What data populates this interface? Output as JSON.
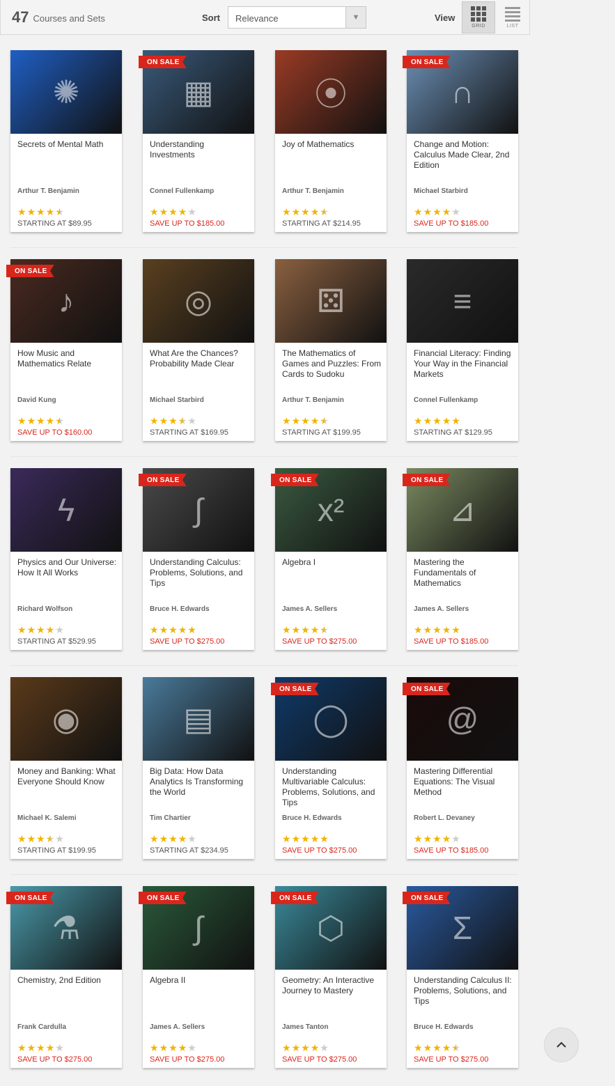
{
  "toolbar": {
    "count": "47",
    "count_label": "Courses and Sets",
    "sort_label": "Sort",
    "sort_value": "Relevance",
    "view_label": "View",
    "grid_label": "GRID",
    "list_label": "LIST"
  },
  "badge_label": "ON SALE",
  "courses": [
    {
      "title": "Secrets of Mental Math",
      "author": "Arthur T. Benjamin",
      "rating": 4.5,
      "price": "STARTING AT $89.95",
      "sale": false,
      "on_sale": false,
      "color": "#1f5fc4",
      "icon": "brain-icon"
    },
    {
      "title": "Understanding Investments",
      "author": "Connel Fullenkamp",
      "rating": 4,
      "price": "SAVE UP TO $185.00",
      "sale": true,
      "on_sale": true,
      "color": "#3a5a7a",
      "icon": "calculator-icon"
    },
    {
      "title": "Joy of Mathematics",
      "author": "Arthur T. Benjamin",
      "rating": 4.5,
      "price": "STARTING AT $214.95",
      "sale": false,
      "on_sale": false,
      "color": "#9a3b25",
      "icon": "abacus-icon"
    },
    {
      "title": "Change and Motion: Calculus Made Clear, 2nd Edition",
      "author": "Michael Starbird",
      "rating": 4,
      "price": "SAVE UP TO $185.00",
      "sale": true,
      "on_sale": true,
      "color": "#6b8fb5",
      "icon": "arch-icon"
    },
    {
      "title": "How Music and Mathematics Relate",
      "author": "David Kung",
      "rating": 4.5,
      "price": "SAVE UP TO $160.00",
      "sale": true,
      "on_sale": true,
      "color": "#4a2a20",
      "icon": "metronome-icon"
    },
    {
      "title": "What Are the Chances? Probability Made Clear",
      "author": "Michael Starbird",
      "rating": 3.5,
      "price": "STARTING AT $169.95",
      "sale": false,
      "on_sale": false,
      "color": "#5a4020",
      "icon": "roulette-icon"
    },
    {
      "title": "The Mathematics of Games and Puzzles: From Cards to Sudoku",
      "author": "Arthur T. Benjamin",
      "rating": 4.5,
      "price": "STARTING AT $199.95",
      "sale": false,
      "on_sale": false,
      "color": "#8a6040",
      "icon": "dice-icon"
    },
    {
      "title": "Financial Literacy: Finding Your Way in the Financial Markets",
      "author": "Connel Fullenkamp",
      "rating": 5,
      "price": "STARTING AT $129.95",
      "sale": false,
      "on_sale": false,
      "color": "#2a2a2a",
      "icon": "ticker-icon"
    },
    {
      "title": "Physics and Our Universe: How It All Works",
      "author": "Richard Wolfson",
      "rating": 4,
      "price": "STARTING AT $529.95",
      "sale": false,
      "on_sale": false,
      "color": "#3a2a5a",
      "icon": "lightning-icon"
    },
    {
      "title": "Understanding Calculus: Problems, Solutions, and Tips",
      "author": "Bruce H. Edwards",
      "rating": 5,
      "price": "SAVE UP TO $275.00",
      "sale": true,
      "on_sale": true,
      "color": "#4a4a4a",
      "icon": "chalkboard-icon"
    },
    {
      "title": "Algebra I",
      "author": "James A. Sellers",
      "rating": 4.5,
      "price": "SAVE UP TO $275.00",
      "sale": true,
      "on_sale": true,
      "color": "#3a5a40",
      "icon": "equation-icon"
    },
    {
      "title": "Mastering the Fundamentals of Mathematics",
      "author": "James A. Sellers",
      "rating": 5,
      "price": "SAVE UP TO $185.00",
      "sale": true,
      "on_sale": true,
      "color": "#7a8a60",
      "icon": "ruler-icon"
    },
    {
      "title": "Money and Banking: What Everyone Should Know",
      "author": "Michael K. Salemi",
      "rating": 3.5,
      "price": "STARTING AT $199.95",
      "sale": false,
      "on_sale": false,
      "color": "#5a3a1a",
      "icon": "vault-icon"
    },
    {
      "title": "Big Data: How Data Analytics Is Transforming the World",
      "author": "Tim Chartier",
      "rating": 4,
      "price": "STARTING AT $234.95",
      "sale": false,
      "on_sale": false,
      "color": "#4a7a9a",
      "icon": "data-screen-icon"
    },
    {
      "title": "Understanding Multivariable Calculus: Problems, Solutions, and Tips",
      "author": "Bruce H. Edwards",
      "rating": 5,
      "price": "SAVE UP TO $275.00",
      "sale": true,
      "on_sale": true,
      "color": "#103a6a",
      "icon": "torus-icon"
    },
    {
      "title": "Mastering Differential Equations: The Visual Method",
      "author": "Robert L. Devaney",
      "rating": 4,
      "price": "SAVE UP TO $185.00",
      "sale": true,
      "on_sale": true,
      "color": "#1a0a0a",
      "icon": "spiral-icon"
    },
    {
      "title": "Chemistry, 2nd Edition",
      "author": "Frank Cardulla",
      "rating": 4,
      "price": "SAVE UP TO $275.00",
      "sale": true,
      "on_sale": true,
      "color": "#4a9aaa",
      "icon": "beaker-icon"
    },
    {
      "title": "Algebra II",
      "author": "James A. Sellers",
      "rating": 4,
      "price": "SAVE UP TO $275.00",
      "sale": true,
      "on_sale": true,
      "color": "#2a5a3a",
      "icon": "chalkboard-icon"
    },
    {
      "title": "Geometry: An Interactive Journey to Mastery",
      "author": "James Tanton",
      "rating": 4,
      "price": "SAVE UP TO $275.00",
      "sale": true,
      "on_sale": true,
      "color": "#3a8a9a",
      "icon": "polyhedron-icon"
    },
    {
      "title": "Understanding Calculus II: Problems, Solutions, and Tips",
      "author": "Bruce H. Edwards",
      "rating": 4.5,
      "price": "SAVE UP TO $275.00",
      "sale": true,
      "on_sale": true,
      "color": "#2a5aa0",
      "icon": "formula-icon"
    }
  ]
}
